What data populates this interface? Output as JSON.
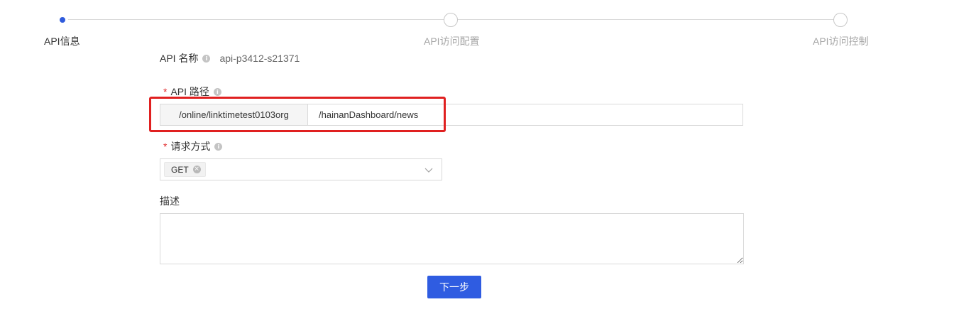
{
  "steps": [
    {
      "label": "API信息",
      "state": "active"
    },
    {
      "label": "API访问配置",
      "state": "pending"
    },
    {
      "label": "API访问控制",
      "state": "pending"
    }
  ],
  "form": {
    "api_name": {
      "label": "API 名称",
      "value": "api-p3412-s21371",
      "info_icon": "info-circle-icon"
    },
    "api_path": {
      "required_mark": "*",
      "label": "API 路径",
      "info_icon": "info-circle-icon",
      "prefix": "/online/linktimetest0103org",
      "value": "/hainanDashboard/news"
    },
    "method": {
      "required_mark": "*",
      "label": "请求方式",
      "info_icon": "info-circle-icon",
      "selected": [
        "GET"
      ],
      "tag_close_icon": "close-circle-icon",
      "dropdown_icon": "chevron-down-icon"
    },
    "description": {
      "label": "描述",
      "value": ""
    }
  },
  "actions": {
    "next_label": "下一步"
  },
  "colors": {
    "primary": "#2f5ce1",
    "highlight": "#e02020",
    "required": "#e0292b"
  }
}
